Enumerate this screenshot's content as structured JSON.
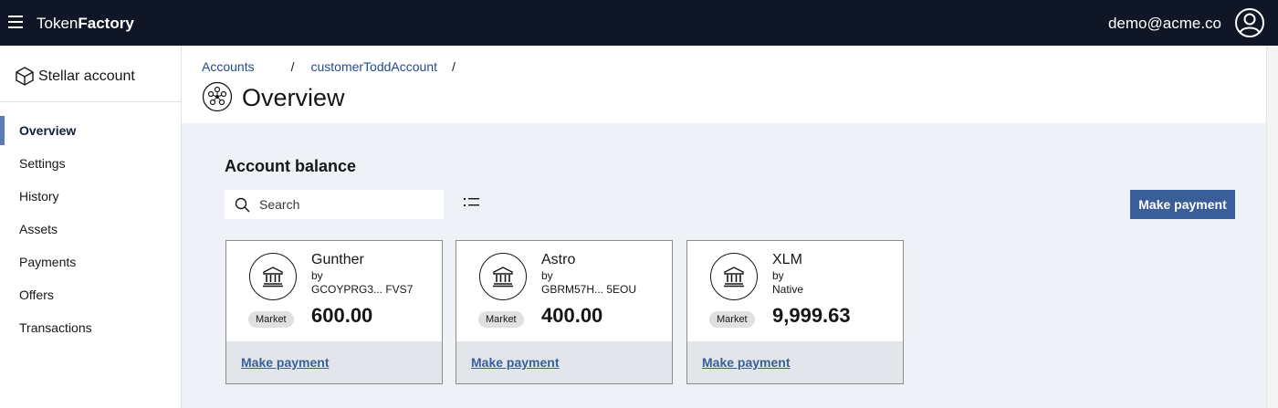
{
  "header": {
    "brand_light": "Token",
    "brand_bold": "Factory",
    "user_email": "demo@acme.co"
  },
  "sidebar": {
    "title": "Stellar account",
    "items": [
      {
        "label": "Overview",
        "active": true
      },
      {
        "label": "Settings"
      },
      {
        "label": "History"
      },
      {
        "label": "Assets"
      },
      {
        "label": "Payments"
      },
      {
        "label": "Offers"
      },
      {
        "label": "Transactions"
      }
    ]
  },
  "breadcrumb": {
    "items": [
      "Accounts",
      "customerToddAccount"
    ],
    "separator": "/"
  },
  "page": {
    "title": "Overview"
  },
  "balance": {
    "title": "Account balance",
    "search_placeholder": "Search",
    "make_payment_label": "Make payment",
    "cards": [
      {
        "name": "Gunther",
        "by": "by",
        "issuer": "GCOYPRG3... FVS7",
        "tag": "Market",
        "amount": "600.00",
        "link": "Make payment"
      },
      {
        "name": "Astro",
        "by": "by",
        "issuer": "GBRM57H...  5EOU",
        "tag": "Market",
        "amount": "400.00",
        "link": "Make payment"
      },
      {
        "name": "XLM",
        "by": "by",
        "issuer": "Native",
        "tag": "Market",
        "amount": "9,999.63",
        "link": "Make payment"
      }
    ]
  },
  "colors": {
    "topbar": "#0f1726",
    "accent": "#3a5f98",
    "active_indicator": "#5b7bb8",
    "content_bg": "#eef1f5"
  }
}
